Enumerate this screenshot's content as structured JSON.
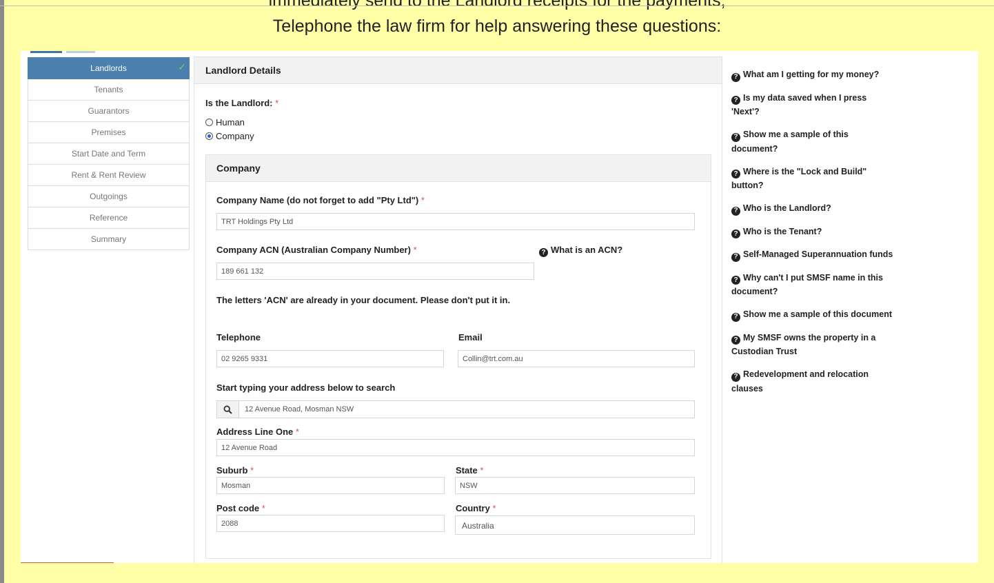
{
  "banner": {
    "cut_line": "immediately send to the Landlord receipts for the payments;",
    "line": "Telephone the law firm for help answering these questions:"
  },
  "sidebar": {
    "items": [
      {
        "label": "Landlords",
        "active": true
      },
      {
        "label": "Tenants"
      },
      {
        "label": "Guarantors"
      },
      {
        "label": "Premises"
      },
      {
        "label": "Start Date and Term"
      },
      {
        "label": "Rent & Rent Review"
      },
      {
        "label": "Outgoings"
      },
      {
        "label": "Reference"
      },
      {
        "label": "Summary"
      }
    ]
  },
  "main": {
    "header": "Landlord Details",
    "landlord_type_label": "Is the Landlord:",
    "required_mark": "*",
    "options": [
      "Human",
      "Company"
    ],
    "selected_option": "Company",
    "company": {
      "header": "Company",
      "name_label": "Company Name (do not forget to add \"Pty Ltd\")",
      "name_value": "TRT Holdings Pty Ltd",
      "acn_label": "Company ACN (Australian Company Number)",
      "acn_help": "What is an ACN?",
      "acn_value": "189 661 132",
      "acn_note": "The letters 'ACN' are already in your document. Please don't put it in.",
      "telephone_label": "Telephone",
      "telephone_value": "02 9265 9331",
      "email_label": "Email",
      "email_value": "Collin@trt.com.au",
      "address_search_label": "Start typing your address below to search",
      "address_search_value": "12 Avenue Road, Mosman NSW",
      "address_line_one_label": "Address Line One",
      "address_line_one_value": "12 Avenue Road",
      "suburb_label": "Suburb",
      "suburb_value": "Mosman",
      "state_label": "State",
      "state_value": "NSW",
      "postcode_label": "Post code",
      "postcode_value": "2088",
      "country_label": "Country",
      "country_value": "Australia"
    }
  },
  "faq": {
    "items": [
      "What am I getting for my money?",
      "Is my data saved when I press 'Next'?",
      "Show me a sample of this document?",
      "Where is the \"Lock and Build\" button?",
      "Who is the Landlord?",
      "Who is the Tenant?",
      "Self-Managed Superannuation funds",
      "Why can't I put SMSF name in this document?",
      "Show me a sample of this document",
      "My SMSF owns the property in a Custodian Trust",
      "Redevelopment and relocation clauses"
    ]
  },
  "colors": {
    "background": "#ffffa8",
    "sidebar_active": "#4a7fae",
    "required": "#d9534f",
    "check": "#5fd35f"
  }
}
